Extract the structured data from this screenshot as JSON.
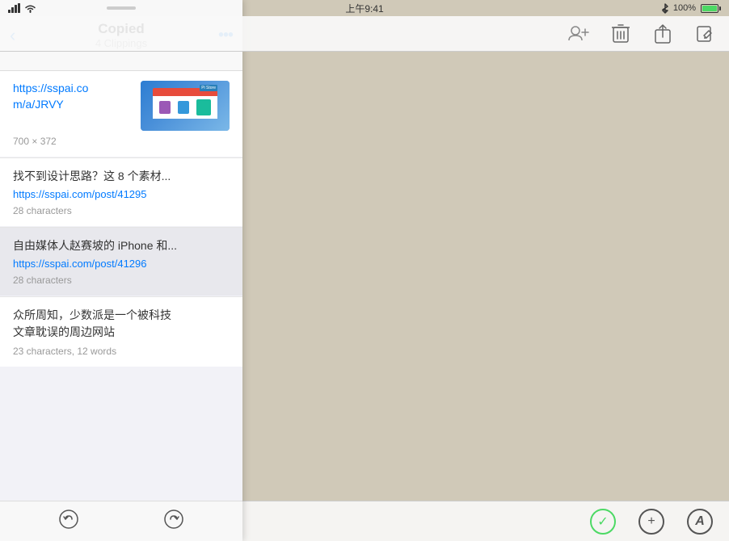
{
  "statusBar": {
    "time": "上午9:41",
    "wifi": "WiFi",
    "bluetooth": "BT",
    "battery": "100%"
  },
  "toolbar": {
    "addContact": "add-contact",
    "trash": "🗑",
    "share": "share",
    "edit": "edit"
  },
  "copiedApp": {
    "title": "Copied",
    "subtitle": "4 Clippings",
    "backLabel": "‹",
    "moreLabel": "•••",
    "dragHandle": true
  },
  "clippings": [
    {
      "id": 1,
      "url": "https://sspai.co\nm/a/JRVY",
      "hasThumbnail": true,
      "dimensions": "700 × 372",
      "chars": null,
      "words": null
    },
    {
      "id": 2,
      "text": "找不到设计思路？这 8 个素材...",
      "url": "https://sspai.com/post/41295",
      "chars": "28 characters",
      "words": null
    },
    {
      "id": 3,
      "text": "自由媒体人赵赛坡的 iPhone 和...",
      "url": "https://sspai.com/post/41296",
      "chars": "28 characters",
      "words": null
    },
    {
      "id": 4,
      "text": "众所周知，少数派是一个被科技\n文章耽误的周边网站",
      "url": null,
      "chars": "23 characters, 12 words",
      "words": null
    }
  ],
  "bottomBar": {
    "leftIcon": "undo",
    "centerIcon": "redo"
  },
  "bottomToolbarRight": {
    "checkIcon": "✓",
    "plusIcon": "+",
    "pencilIcon": "A"
  }
}
